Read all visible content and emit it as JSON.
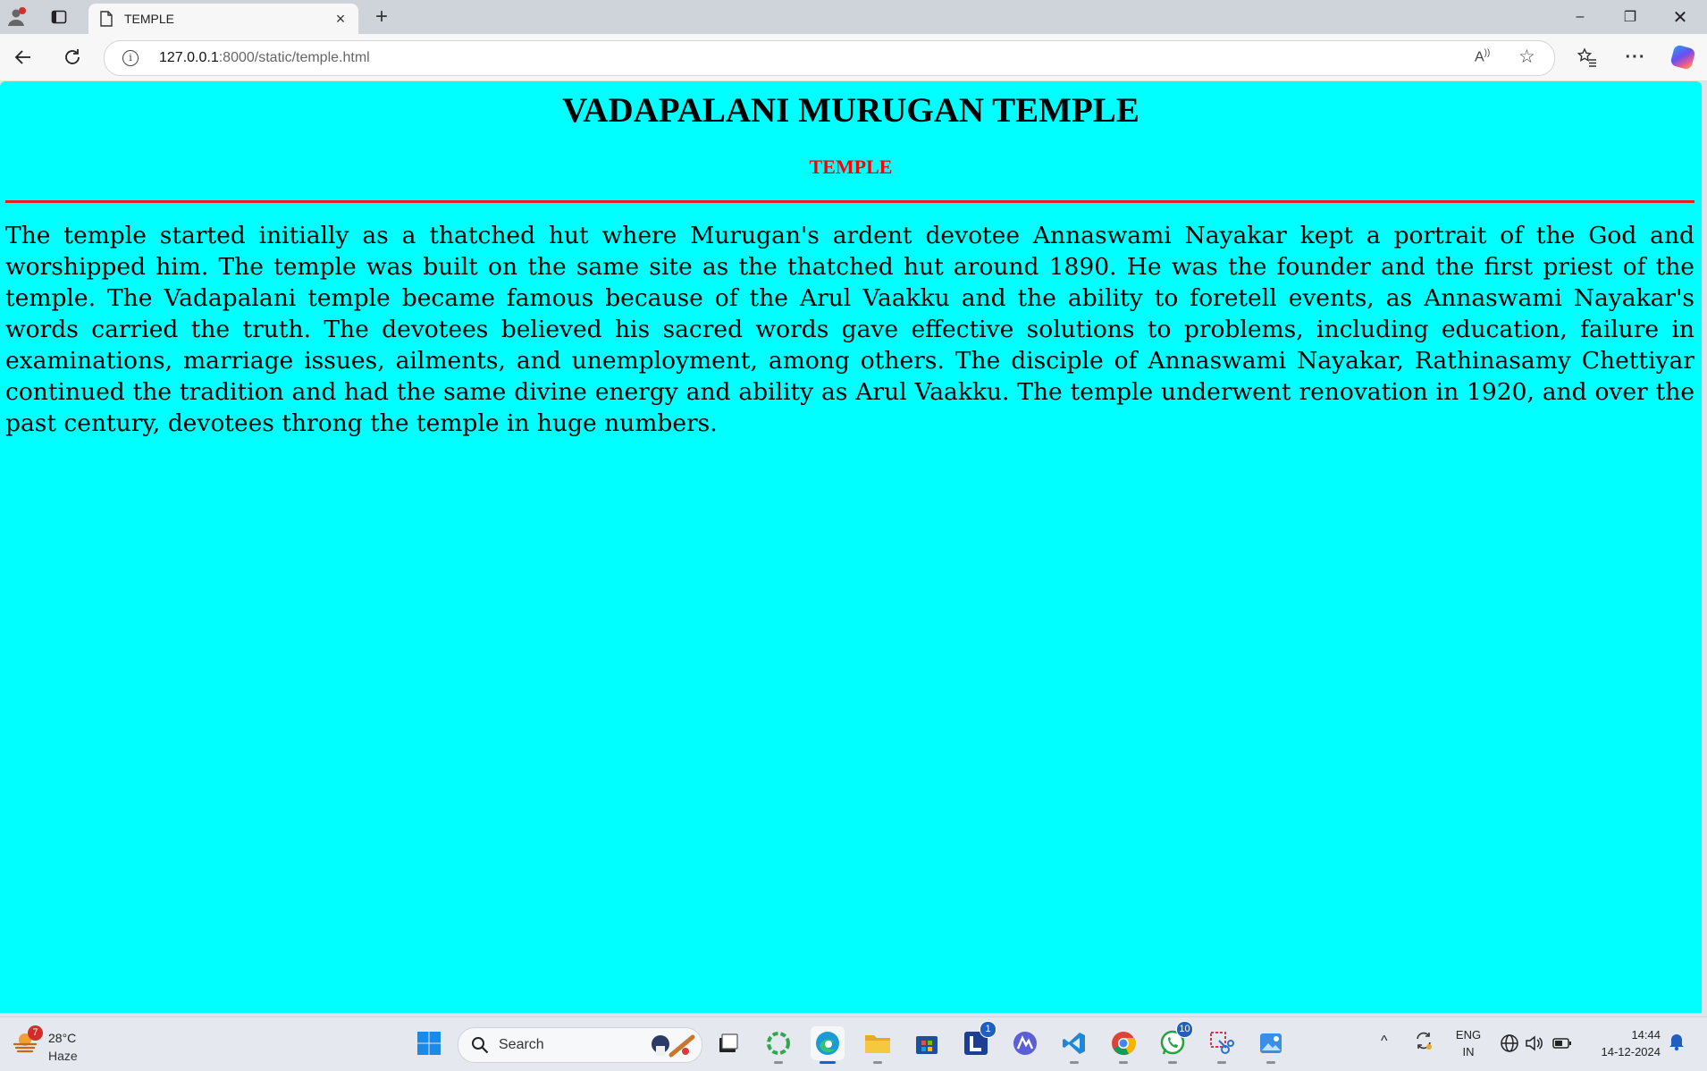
{
  "browser": {
    "tab": {
      "title": "TEMPLE",
      "close_glyph": "×"
    },
    "new_tab_glyph": "+",
    "window_controls": {
      "minimize": "–",
      "maximize": "❐",
      "close": "✕"
    },
    "address": {
      "host": "127.0.0.1",
      "path": ":8000/static/temple.html"
    },
    "icons": [
      "profile-icon",
      "tabs-icon",
      "page-icon",
      "back-icon",
      "reload-icon",
      "info-icon",
      "read-aloud-icon",
      "favorite-star-icon",
      "favorites-icon",
      "more-icon",
      "copilot-icon"
    ]
  },
  "page": {
    "background": "#00ffff",
    "heading": "VADAPALANI MURUGAN TEMPLE",
    "subheading": "TEMPLE",
    "subheading_color": "#ff0000",
    "rule_color": "#e0212b",
    "body": "The temple started initially as a thatched hut where Murugan's ardent devotee Annaswami Nayakar kept a portrait of the God and worshipped him. The temple was built on the same site as the thatched hut around 1890. He was the founder and the first priest of the temple. The Vadapalani temple became famous because of the Arul Vaakku and the ability to foretell events, as Annaswami Nayakar's words carried the truth. The devotees believed his sacred words gave effective solutions to problems, including education, failure in examinations, marriage issues, ailments, and unemployment, among others. The disciple of Annaswami Nayakar, Rathinasamy Chettiyar continued the tradition and had the same divine energy and ability as Arul Vaakku. The temple underwent renovation in 1920, and over the past century, devotees throng the temple in huge numbers."
  },
  "taskbar": {
    "weather": {
      "temp": "28°C",
      "condition": "Haze",
      "badge": "7"
    },
    "search_label": "Search",
    "apps": [
      {
        "name": "windows-start",
        "badge": ""
      },
      {
        "name": "task-view",
        "badge": ""
      },
      {
        "name": "copilot-ring",
        "badge": ""
      },
      {
        "name": "edge",
        "badge": ""
      },
      {
        "name": "file-explorer",
        "badge": ""
      },
      {
        "name": "microsoft-store",
        "badge": ""
      },
      {
        "name": "l-app",
        "badge": "1"
      },
      {
        "name": "a-app",
        "badge": ""
      },
      {
        "name": "vs-code",
        "badge": ""
      },
      {
        "name": "chrome",
        "badge": ""
      },
      {
        "name": "whatsapp",
        "badge": "10"
      },
      {
        "name": "snipping-tool",
        "badge": ""
      },
      {
        "name": "photos",
        "badge": ""
      }
    ],
    "tray": {
      "chevron": "^",
      "language_line1": "ENG",
      "language_line2": "IN",
      "time": "14:44",
      "date": "14-12-2024"
    }
  }
}
